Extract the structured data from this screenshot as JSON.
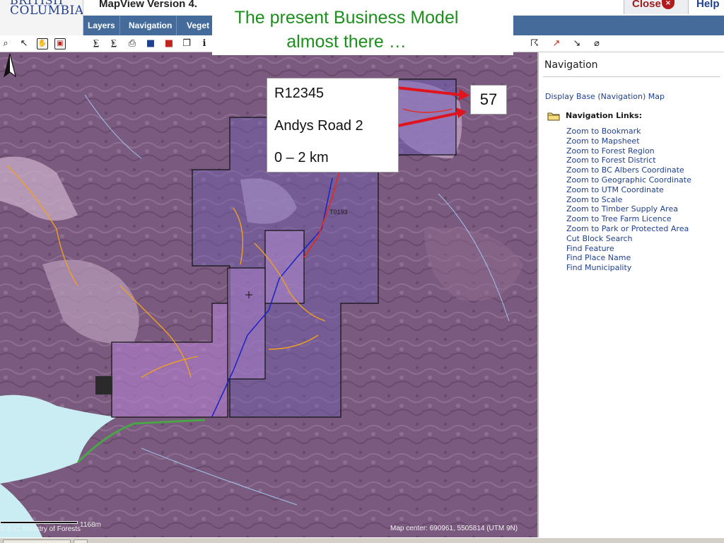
{
  "header": {
    "logo_line1": "BRITISH",
    "logo_line2": "COLUMBIA",
    "app_title": "MapView Version 4.",
    "close_label": "Close",
    "close_icon_glyph": "×",
    "help_label": "Help"
  },
  "tabs": [
    "Layers",
    "Navigation",
    "Veget"
  ],
  "toolbar": {
    "left_icons": [
      "zoom-icon",
      "pan-back-icon",
      "hand-icon",
      "identify-icon",
      "print-preview-icon",
      "print-setup-icon",
      "print-icon",
      "save-icon",
      "save-as-icon",
      "open-folder-icon",
      "info-icon"
    ],
    "right_icons": [
      "measure-icon",
      "pointer-icon",
      "draw-line-icon",
      "draw-icon",
      "eraser-icon"
    ]
  },
  "map": {
    "scale_distance": "1168m",
    "copyright": "© B.C. Ministry of Forests",
    "map_center": "Map center: 690961, 5505814 (UTM 9N)",
    "road_label": "T0193",
    "north_arrow_icon": "north-arrow-icon"
  },
  "panel": {
    "title": "Navigation",
    "display_link": "Display Base (Navigation) Map",
    "links_header": "Navigation Links:",
    "links": [
      "Zoom to Bookmark",
      "Zoom to Mapsheet",
      "Zoom to Forest Region",
      "Zoom to Forest District",
      "Zoom to BC Albers Coordinate",
      "Zoom to Geographic Coordinate",
      "Zoom to UTM Coordinate",
      "Zoom to Scale",
      "Zoom to Timber Supply Area",
      "Zoom to Tree Farm Licence",
      "Zoom to Park or Protected Area",
      "Cut Block Search",
      "Find Feature",
      "Find Place Name",
      "Find Municipality"
    ]
  },
  "overlay": {
    "title": "The present Business Model almost there …",
    "info_lines": [
      "R12345",
      "Andys Road 2",
      "0 – 2 km"
    ],
    "number": "57"
  },
  "colors": {
    "tabbar": "#446b99",
    "link": "#1f3f8f",
    "overlay_title": "#1c8f1c",
    "arrow": "#e0141e"
  }
}
